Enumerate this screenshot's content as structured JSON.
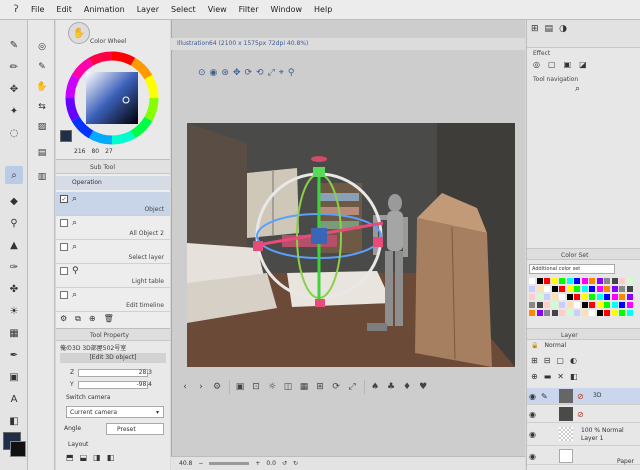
{
  "menu": [
    "File",
    "Edit",
    "Animation",
    "Layer",
    "Select",
    "View",
    "Filter",
    "Window",
    "Help"
  ],
  "color_wheel": {
    "title": "Color Wheel",
    "values": [
      "216",
      "80",
      "27"
    ],
    "hue_ring": "on"
  },
  "sub_tool": {
    "title": "Sub Tool",
    "group": "Operation",
    "items": [
      "Object",
      "All Object 2",
      "Select layer",
      "Light table",
      "Edit timeline"
    ]
  },
  "tool_property": {
    "title": "Tool Property",
    "object_name": "俺の3D 3D部屋502号室",
    "mode": "[Edit 3D object]",
    "z_label": "Z",
    "z_value": "28.3",
    "y_label": "Y",
    "y_value": "-98.4",
    "switch_camera": "Switch camera",
    "current_camera": "Current camera",
    "angle": "Angle",
    "preset": "Preset",
    "layout": "Layout"
  },
  "document": {
    "tab": "Illustration64 (2100 x 1575px 72dpi 40.8%)"
  },
  "status": {
    "zoom": "40.8",
    "rotation": "0.0"
  },
  "effect": {
    "title": "Effect"
  },
  "tool_navigation": {
    "title": "Tool navigation"
  },
  "color_set": {
    "title": "Color Set",
    "selected": "Additional color set"
  },
  "layer": {
    "title": "Layer",
    "blend": "Normal",
    "opacity": "100",
    "rows": [
      {
        "name": "3D",
        "visible": "true"
      },
      {
        "name": "",
        "visible": "true"
      },
      {
        "name": "100 % Normal",
        "sub": "Layer 1",
        "visible": "true"
      },
      {
        "name": "Paper",
        "visible": "true"
      }
    ]
  },
  "icons": [
    "menu-icon",
    "undo-icon",
    "redo-icon",
    "zoom-icon",
    "move-icon",
    "pen-icon",
    "eraser-icon",
    "fill-icon",
    "eyedropper-icon",
    "text-icon",
    "camera-icon",
    "light-icon",
    "lock-icon",
    "eye-icon"
  ],
  "colors": {
    "selection": "#b9cbe6",
    "accent": "#3b66b8",
    "scene_wall": "#4a4a48",
    "floor": "#6b4a38"
  }
}
